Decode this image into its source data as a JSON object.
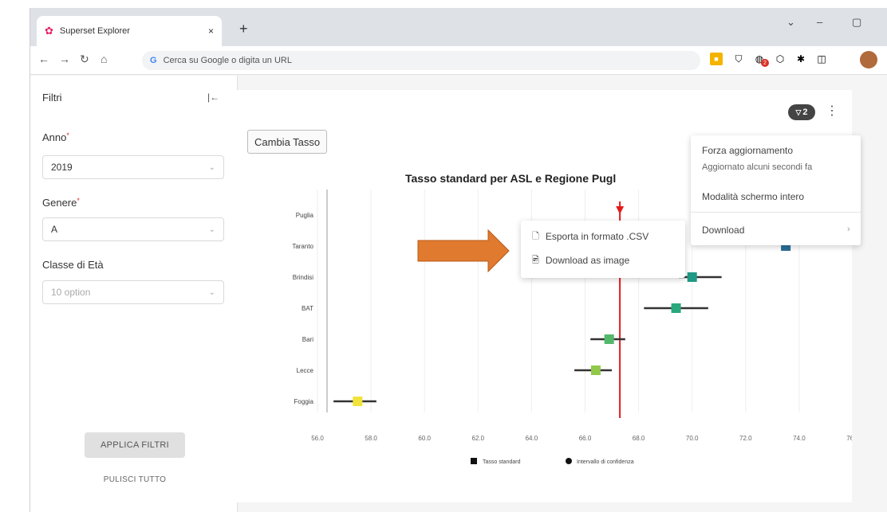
{
  "browser": {
    "tab_title": "Superset Explorer",
    "tab_close": "×",
    "new_tab": "+",
    "address_placeholder": "Cerca su Google o digita un URL",
    "ext_badge": "2"
  },
  "sidebar": {
    "title": "Filtri",
    "collapse": "|←",
    "filters": [
      {
        "label": "Anno",
        "value": "2019"
      },
      {
        "label": "Genere",
        "value": "A"
      },
      {
        "label": "Classe di Età",
        "placeholder": "10 option"
      }
    ],
    "apply": "APPLICA FILTRI",
    "clear": "PULISCI TUTTO"
  },
  "card": {
    "change_button": "Cambia Tasso",
    "filter_badge": "2",
    "chart_title": "Tasso standard per ASL e Regione Pugl"
  },
  "context_menu": {
    "items": [
      {
        "label": "Esporta in formato .CSV",
        "icon": "file-icon"
      },
      {
        "label": "Download as image",
        "icon": "image-icon"
      }
    ]
  },
  "dropdown_menu": {
    "force_refresh": "Forza aggiornamento",
    "updated_note": "Aggiornato alcuni secondi fa",
    "fullscreen": "Modalità schermo intero",
    "download": "Download"
  },
  "colors": {
    "reference_line": "#e41a1c",
    "arrow": "#e07a2e"
  },
  "chart_data": {
    "type": "scatter",
    "categories": [
      "Puglia",
      "Taranto",
      "Brindisi",
      "BAT",
      "Bari",
      "Lecce",
      "Foggia"
    ],
    "series": [
      {
        "name": "Tasso standard",
        "values": [
          null,
          73.5,
          70.0,
          69.4,
          66.9,
          66.4,
          57.5
        ]
      },
      {
        "name": "Intervallo di confidenza",
        "lower": [
          null,
          null,
          69.5,
          68.2,
          66.2,
          65.6,
          56.6
        ],
        "upper": [
          null,
          null,
          71.1,
          70.6,
          67.5,
          67.0,
          58.2
        ]
      }
    ],
    "reference_line": 67.3,
    "xticks": [
      "56.0",
      "58.0",
      "60.0",
      "62.0",
      "64.0",
      "66.0",
      "68.0",
      "70.0",
      "72.0",
      "74.0",
      "76.0"
    ],
    "xlim": [
      56,
      76
    ],
    "legend": [
      "Tasso standard",
      "Intervallo di confidenza"
    ],
    "legend_position": "bottom",
    "point_colors": [
      null,
      "#2c6e99",
      "#1f9a84",
      "#2aa77c",
      "#53b86a",
      "#92c84a",
      "#f1e33a"
    ],
    "grid": true
  }
}
